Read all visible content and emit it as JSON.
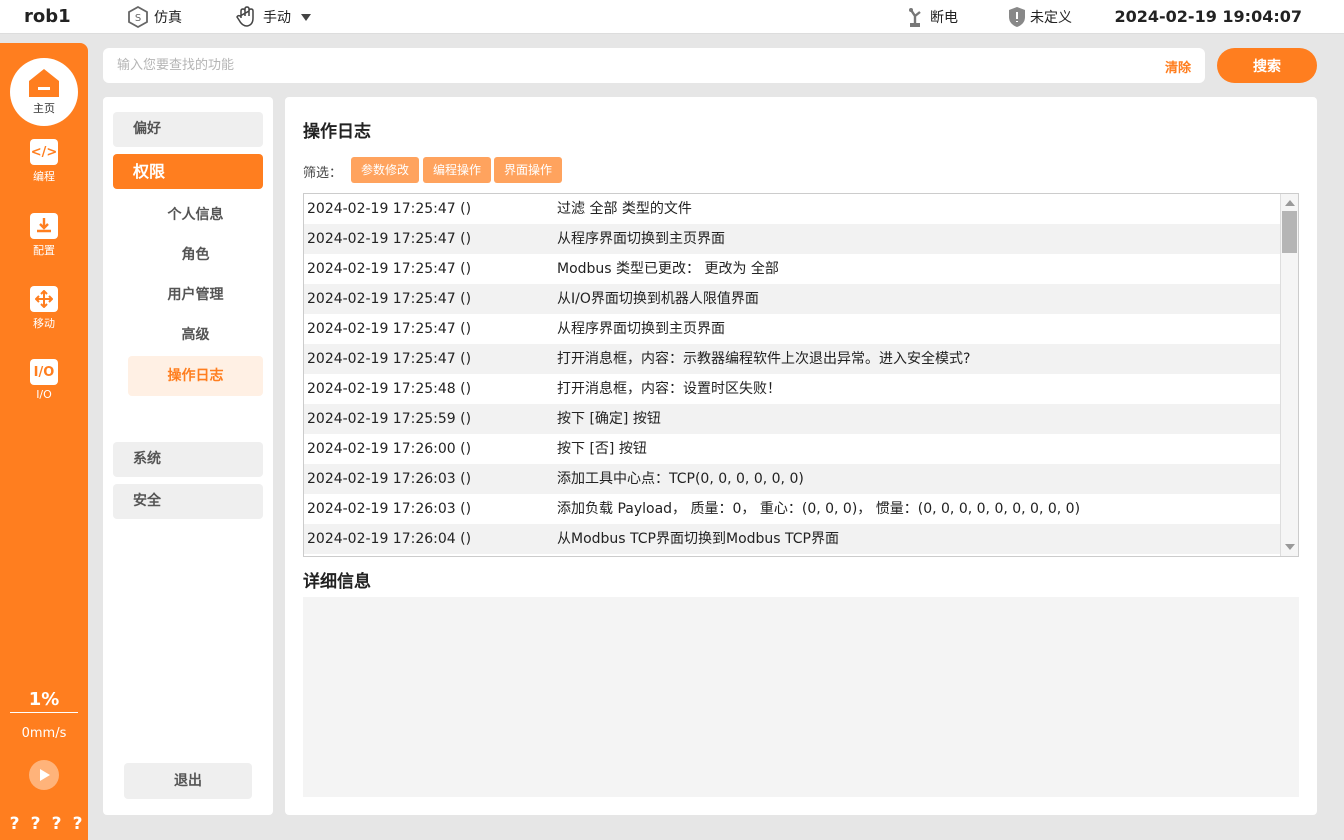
{
  "topbar": {
    "robot_name": "rob1",
    "sim_label": "仿真",
    "mode_label": "手动",
    "power_label": "断电",
    "safety_label": "未定义",
    "datetime": "2024-02-19 19:04:07"
  },
  "sidebar": {
    "home_label": "主页",
    "items": [
      {
        "label": "编程",
        "icon": "code-icon"
      },
      {
        "label": "配置",
        "icon": "config-download-icon"
      },
      {
        "label": "移动",
        "icon": "move-arrows-icon"
      },
      {
        "label": "I/O",
        "icon": "io-icon"
      }
    ],
    "speed_percent": "1%",
    "speed_value": "0mm/s",
    "help": [
      "?",
      "?",
      "?",
      "?"
    ]
  },
  "search": {
    "placeholder": "输入您要查找的功能",
    "value": "",
    "clear_label": "清除",
    "search_label": "搜索"
  },
  "menu": {
    "groups": [
      "偏好",
      "权限",
      "系统",
      "安全"
    ],
    "sub_items": [
      "个人信息",
      "角色",
      "用户管理",
      "高级",
      "操作日志"
    ],
    "logout_label": "退出"
  },
  "content": {
    "title": "操作日志",
    "filter_label": "筛选：",
    "filters": [
      "参数修改",
      "编程操作",
      "界面操作"
    ],
    "detail_title": "详细信息",
    "detail_text": ""
  },
  "log": [
    {
      "time": "2024-02-19 17:25:47  ()",
      "msg": "过滤 全部 类型的文件"
    },
    {
      "time": "2024-02-19 17:25:47  ()",
      "msg": "从程序界面切换到主页界面"
    },
    {
      "time": "2024-02-19 17:25:47  ()",
      "msg": "Modbus 类型已更改：  更改为 全部"
    },
    {
      "time": "2024-02-19 17:25:47  ()",
      "msg": "从I/O界面切换到机器人限值界面"
    },
    {
      "time": "2024-02-19 17:25:47  ()",
      "msg": "从程序界面切换到主页界面"
    },
    {
      "time": "2024-02-19 17:25:47  ()",
      "msg": "打开消息框，内容：示教器编程软件上次退出异常。进入安全模式?"
    },
    {
      "time": "2024-02-19 17:25:48  ()",
      "msg": "打开消息框，内容：设置时区失败！"
    },
    {
      "time": "2024-02-19 17:25:59  ()",
      "msg": "按下 [确定] 按钮"
    },
    {
      "time": "2024-02-19 17:26:00  ()",
      "msg": "按下 [否] 按钮"
    },
    {
      "time": "2024-02-19 17:26:03  ()",
      "msg": "添加工具中心点：TCP(0, 0, 0, 0, 0, 0)"
    },
    {
      "time": "2024-02-19 17:26:03  ()",
      "msg": "添加负载 Payload，  质量：0，   重心：(0, 0, 0)，   惯量：(0, 0, 0, 0, 0, 0, 0, 0, 0)"
    },
    {
      "time": "2024-02-19 17:26:04  ()",
      "msg": "从Modbus TCP界面切换到Modbus TCP界面"
    }
  ]
}
